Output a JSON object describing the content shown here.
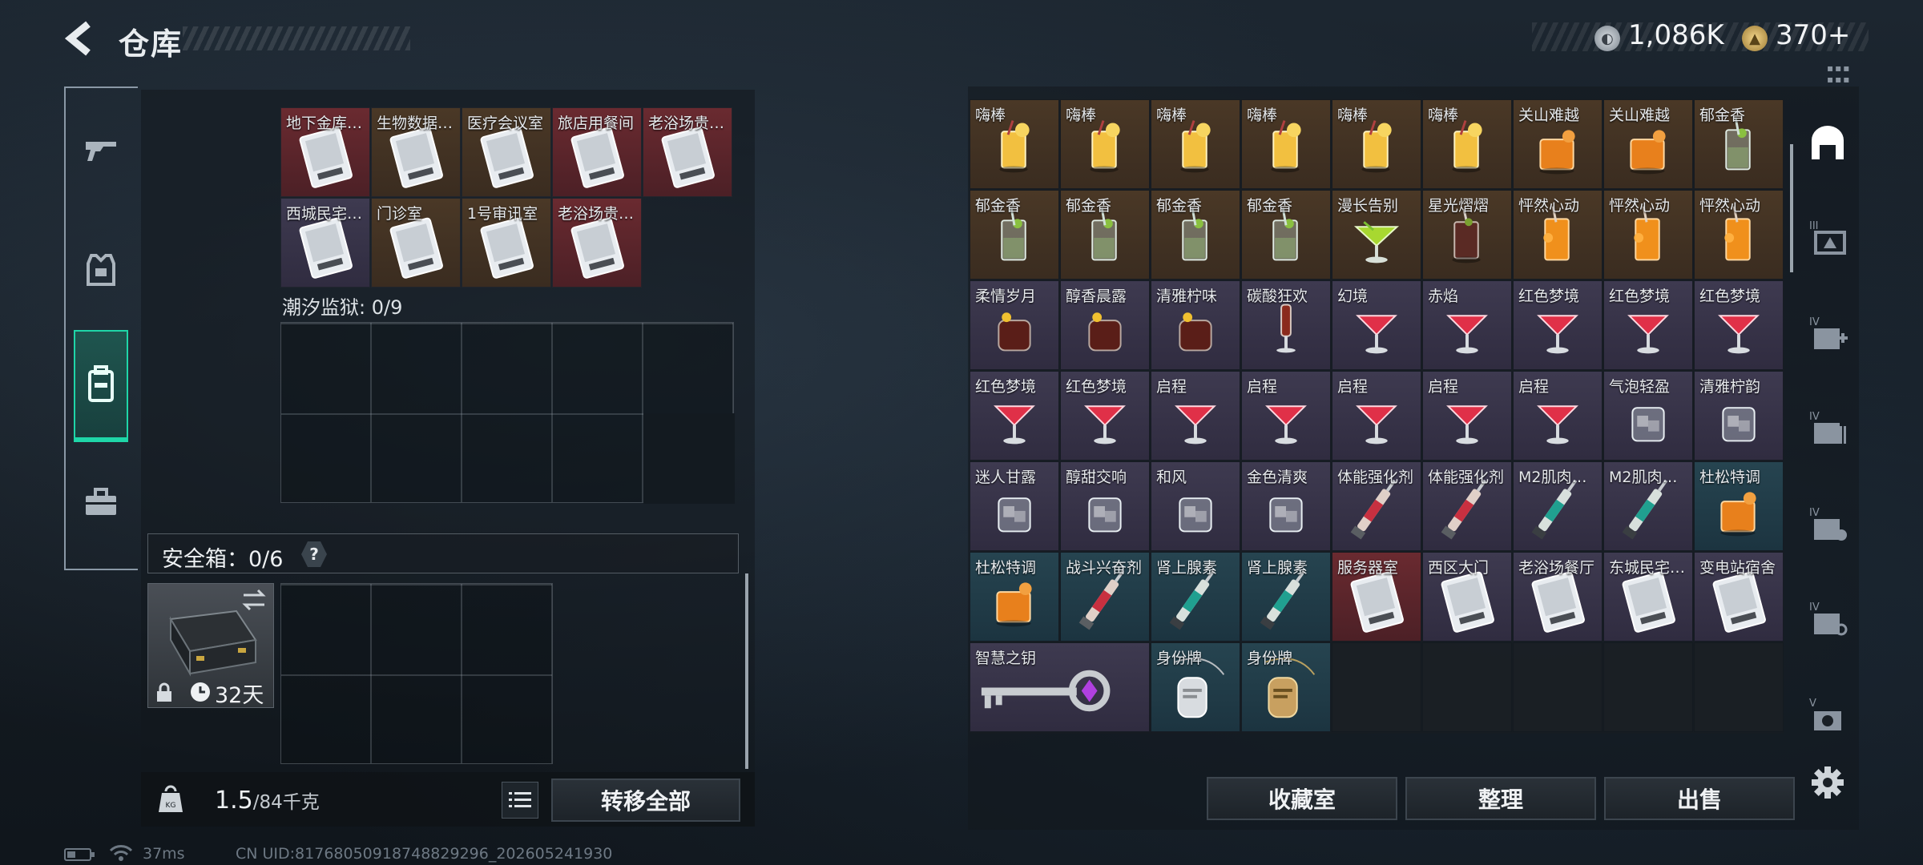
{
  "header": {
    "title": "仓库",
    "currency_1": "1,086K",
    "currency_2": "370+"
  },
  "left": {
    "top_row_1": [
      "地下金库…",
      "生物数据…",
      "医疗会议室",
      "旅店用餐间",
      "老浴场贵…"
    ],
    "top_row_1_bg": [
      "red",
      "brown",
      "brown",
      "red",
      "red"
    ],
    "top_row_2": [
      "西城民宅…",
      "门诊室",
      "1号审讯室",
      "老浴场贵…"
    ],
    "top_row_2_bg": [
      "purple",
      "brown",
      "brown",
      "red"
    ],
    "prison_label": "潮汐监狱: 0/9",
    "safe_label": "安全箱：0/6",
    "safe_help": "?",
    "safe_days": "32天",
    "weight_value": "1.5",
    "weight_max": "/84千克",
    "transfer_all": "转移全部"
  },
  "right": {
    "items": [
      {
        "label": "嗨棒",
        "bg": "brown",
        "art": "highball"
      },
      {
        "label": "嗨棒",
        "bg": "brown",
        "art": "highball"
      },
      {
        "label": "嗨棒",
        "bg": "brown",
        "art": "highball"
      },
      {
        "label": "嗨棒",
        "bg": "brown",
        "art": "highball"
      },
      {
        "label": "嗨棒",
        "bg": "brown",
        "art": "highball"
      },
      {
        "label": "嗨棒",
        "bg": "brown",
        "art": "highball"
      },
      {
        "label": "关山难越",
        "bg": "brown",
        "art": "rocks-orange"
      },
      {
        "label": "关山难越",
        "bg": "brown",
        "art": "rocks-orange"
      },
      {
        "label": "郁金香",
        "bg": "brown",
        "art": "mojito"
      },
      {
        "label": "郁金香",
        "bg": "brown",
        "art": "mojito"
      },
      {
        "label": "郁金香",
        "bg": "brown",
        "art": "mojito"
      },
      {
        "label": "郁金香",
        "bg": "brown",
        "art": "mojito"
      },
      {
        "label": "郁金香",
        "bg": "brown",
        "art": "mojito"
      },
      {
        "label": "漫长告别",
        "bg": "brown",
        "art": "martini-green"
      },
      {
        "label": "星光熠熠",
        "bg": "brown",
        "art": "highball-dark"
      },
      {
        "label": "怦然心动",
        "bg": "brown",
        "art": "orange-drink"
      },
      {
        "label": "怦然心动",
        "bg": "brown",
        "art": "orange-drink"
      },
      {
        "label": "怦然心动",
        "bg": "brown",
        "art": "orange-drink"
      },
      {
        "label": "柔情岁月",
        "bg": "purple",
        "art": "rocks-dark"
      },
      {
        "label": "醇香晨露",
        "bg": "purple",
        "art": "rocks-dark"
      },
      {
        "label": "清雅柠味",
        "bg": "purple",
        "art": "rocks-dark"
      },
      {
        "label": "碳酸狂欢",
        "bg": "purple",
        "art": "flute"
      },
      {
        "label": "幻境",
        "bg": "purple",
        "art": "martini-red"
      },
      {
        "label": "赤焰",
        "bg": "purple",
        "art": "martini-red"
      },
      {
        "label": "红色梦境",
        "bg": "purple",
        "art": "martini-red"
      },
      {
        "label": "红色梦境",
        "bg": "purple",
        "art": "martini-red"
      },
      {
        "label": "红色梦境",
        "bg": "purple",
        "art": "martini-red"
      },
      {
        "label": "红色梦境",
        "bg": "purple",
        "art": "martini-red"
      },
      {
        "label": "红色梦境",
        "bg": "purple",
        "art": "martini-red"
      },
      {
        "label": "启程",
        "bg": "purple",
        "art": "martini-red"
      },
      {
        "label": "启程",
        "bg": "purple",
        "art": "martini-red"
      },
      {
        "label": "启程",
        "bg": "purple",
        "art": "martini-red"
      },
      {
        "label": "启程",
        "bg": "purple",
        "art": "martini-red"
      },
      {
        "label": "启程",
        "bg": "purple",
        "art": "martini-red"
      },
      {
        "label": "气泡轻盈",
        "bg": "purple",
        "art": "rocks-clear"
      },
      {
        "label": "清雅柠韵",
        "bg": "purple",
        "art": "rocks-clear"
      },
      {
        "label": "迷人甘露",
        "bg": "purple",
        "art": "rocks-clear"
      },
      {
        "label": "醇甜交响",
        "bg": "purple",
        "art": "rocks-clear"
      },
      {
        "label": "和风",
        "bg": "purple",
        "art": "rocks-clear"
      },
      {
        "label": "金色清爽",
        "bg": "purple",
        "art": "rocks-clear"
      },
      {
        "label": "体能强化剂",
        "bg": "purple",
        "art": "syringe-red"
      },
      {
        "label": "体能强化剂",
        "bg": "purple",
        "art": "syringe-red"
      },
      {
        "label": "M2肌肉…",
        "bg": "purple",
        "art": "syringe-teal"
      },
      {
        "label": "M2肌肉…",
        "bg": "purple",
        "art": "syringe-teal"
      },
      {
        "label": "杜松特调",
        "bg": "teal",
        "art": "rocks-orange"
      },
      {
        "label": "杜松特调",
        "bg": "teal",
        "art": "rocks-orange"
      },
      {
        "label": "战斗兴奋剂",
        "bg": "teal",
        "art": "syringe-red"
      },
      {
        "label": "肾上腺素",
        "bg": "teal",
        "art": "syringe-teal"
      },
      {
        "label": "肾上腺素",
        "bg": "teal",
        "art": "syringe-teal"
      },
      {
        "label": "服务器室",
        "bg": "red",
        "art": "card"
      },
      {
        "label": "西区大门",
        "bg": "purple",
        "art": "card"
      },
      {
        "label": "老浴场餐厅",
        "bg": "purple",
        "art": "card"
      },
      {
        "label": "东城民宅…",
        "bg": "purple",
        "art": "card"
      },
      {
        "label": "变电站宿舍",
        "bg": "purple",
        "art": "card"
      },
      {
        "label": "智慧之钥",
        "bg": "purple",
        "art": "key",
        "wide": true
      },
      {
        "label": "身份牌",
        "bg": "teal",
        "art": "tag-silver"
      },
      {
        "label": "身份牌",
        "bg": "teal",
        "art": "tag-gold"
      }
    ],
    "btn_collection": "收藏室",
    "btn_sort": "整理",
    "btn_sell": "出售"
  },
  "status": {
    "ping": "37ms",
    "uid": "CN UID:81768050918748829296_202605241930"
  }
}
